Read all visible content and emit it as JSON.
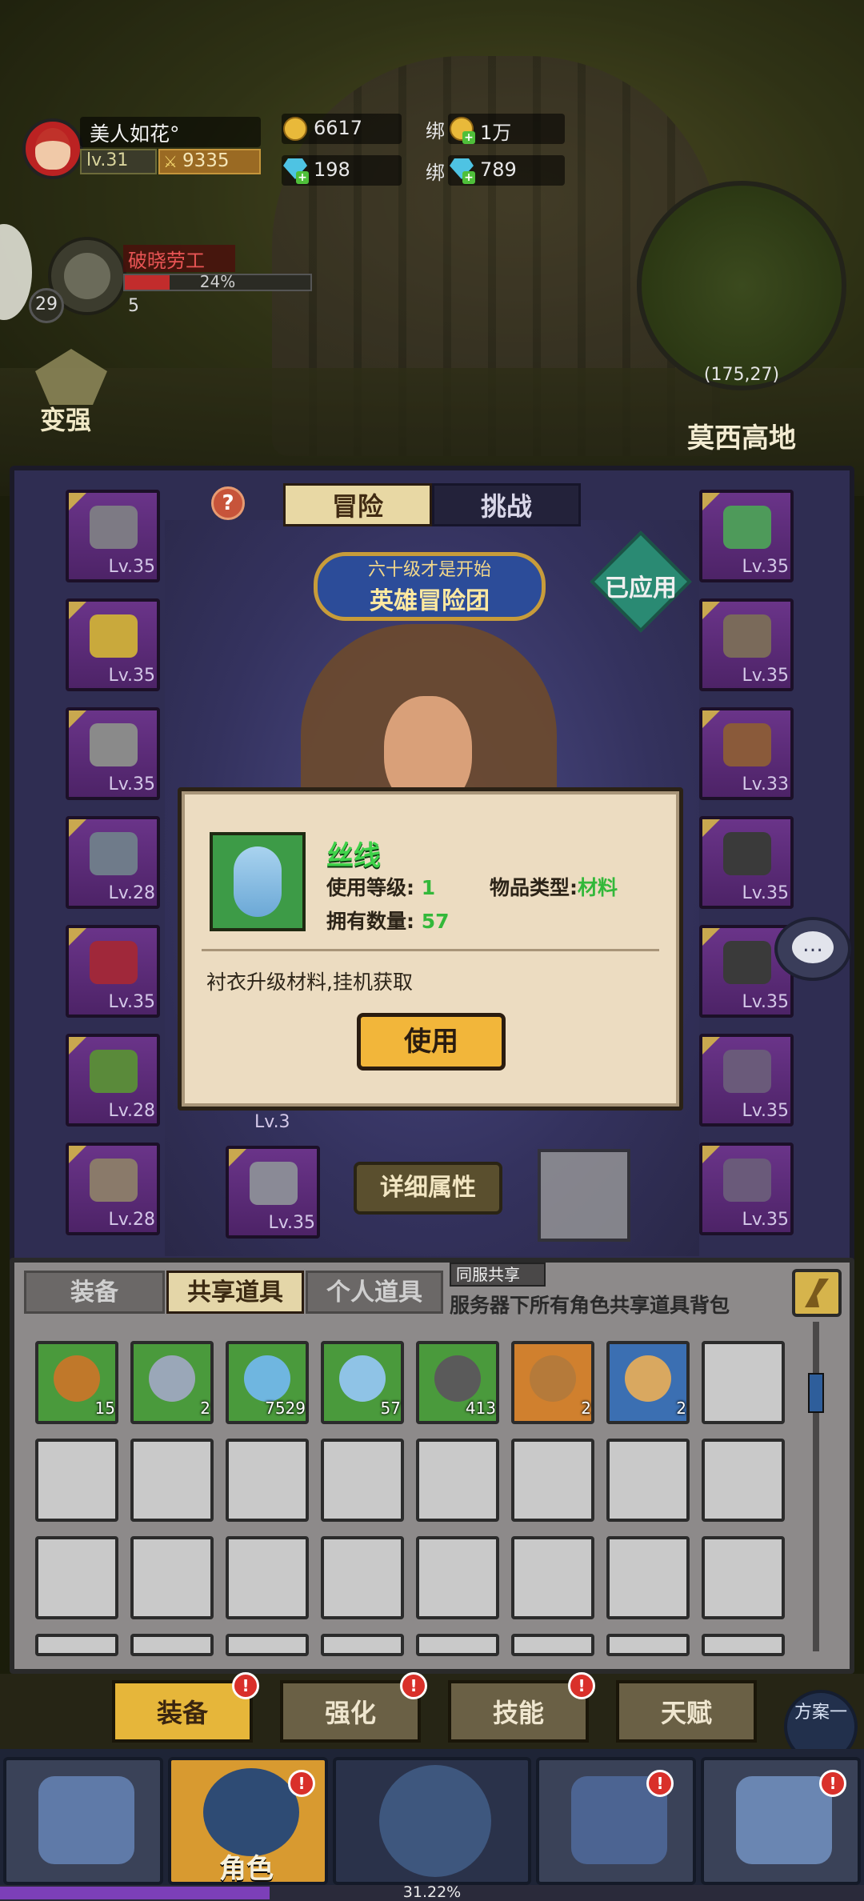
{
  "player": {
    "name": "美人如花°",
    "level": "lv.31",
    "power": "9335"
  },
  "currency": {
    "gold": "6617",
    "bound_label_1": "绑",
    "bound_gold": "1万",
    "diamond": "198",
    "bound_label_2": "绑",
    "bound_diamond": "789"
  },
  "boss": {
    "name": "破晓劳工",
    "progress_text": "24%",
    "progress": 0.24,
    "level": "29",
    "count": "5"
  },
  "side": {
    "strengthen": "变强"
  },
  "minimap": {
    "coord": "(175,27)",
    "place": "莫西高地"
  },
  "panel": {
    "tabs": [
      "冒险",
      "挑战"
    ],
    "help": "?",
    "banner_sub": "六十级才是开始",
    "banner_main": "英雄冒险团",
    "applied": "已应用",
    "detail_button": "详细属性",
    "under_level": "Lv.3",
    "left_slots": [
      "Lv.35",
      "Lv.35",
      "Lv.35",
      "Lv.28",
      "Lv.35",
      "Lv.28",
      "Lv.28"
    ],
    "right_slots": [
      "Lv.35",
      "Lv.35",
      "Lv.33",
      "Lv.35",
      "Lv.35",
      "Lv.35",
      "Lv.35"
    ],
    "bottom_slot": "Lv.35"
  },
  "popup": {
    "item_name": "丝线",
    "use_level_label": "使用等级:",
    "use_level": "1",
    "type_label": "物品类型:",
    "type_value": "材料",
    "owned_label": "拥有数量:",
    "owned_value": "57",
    "description": "衬衣升级材料,挂机获取",
    "use_button": "使用"
  },
  "bag": {
    "tabs": [
      "装备",
      "共享道具",
      "个人道具"
    ],
    "share_tag": "同服共享",
    "share_desc": "服务器下所有角色共享道具背包",
    "items": [
      {
        "count": "15",
        "color": "#c0782a"
      },
      {
        "count": "2",
        "color": "#9aa7b8"
      },
      {
        "count": "7529",
        "color": "#6fb6e0"
      },
      {
        "count": "57",
        "color": "#8fc3e6"
      },
      {
        "count": "413",
        "color": "#5a5a5a"
      },
      {
        "count": "2",
        "color": "#b57a3a"
      },
      {
        "count": "2",
        "color": "#d9a860"
      },
      {
        "count": "",
        "color": ""
      }
    ]
  },
  "subnav": {
    "tabs": [
      "装备",
      "强化",
      "技能",
      "天赋"
    ],
    "badge": "!",
    "plan": "方案一"
  },
  "bottomnav": {
    "role_label": "角色",
    "badge": "!",
    "xp_text": "31.22%",
    "xp": 0.3122
  }
}
